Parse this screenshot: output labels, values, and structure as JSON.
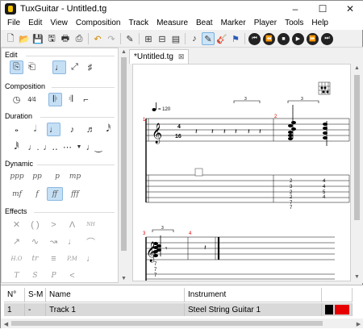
{
  "window": {
    "title": "TuxGuitar - Untitled.tg",
    "controls": [
      "–",
      "☐",
      "✕"
    ]
  },
  "menu": [
    "File",
    "Edit",
    "View",
    "Composition",
    "Track",
    "Measure",
    "Beat",
    "Marker",
    "Player",
    "Tools",
    "Help"
  ],
  "panel": {
    "sections": {
      "edit": "Edit",
      "composition": "Composition",
      "duration": "Duration",
      "dynamic": "Dynamic",
      "effects": "Effects"
    },
    "dynamics": [
      "ppp",
      "pp",
      "p",
      "mp",
      "mf",
      "f",
      "ff",
      "fff"
    ],
    "effects": [
      "NH",
      "H.O",
      "tr",
      "P.M",
      "T",
      "S",
      "P"
    ]
  },
  "document": {
    "tab_label": "*Untitled.tg",
    "tempo": "= 120",
    "time_signature": {
      "top": "4",
      "bottom": "16"
    },
    "measure_numbers": [
      "1",
      "2",
      "3",
      "4"
    ],
    "triplet_marks": [
      "3",
      "3",
      "3"
    ],
    "tab_frets": {
      "measure2_col1": [
        "2",
        "3",
        "2",
        "2",
        "7",
        "7"
      ],
      "measure2_col2": [
        "4",
        "4",
        "5",
        "4"
      ],
      "measure3": [
        "7",
        "7",
        "7"
      ]
    }
  },
  "tracks": {
    "columns": [
      "N°",
      "S-M",
      "Name",
      "Instrument"
    ],
    "rows": [
      {
        "number": "1",
        "sm": "-",
        "name": "Track 1",
        "instrument": "Steel String Guitar 1",
        "color": "#e60000"
      }
    ]
  }
}
